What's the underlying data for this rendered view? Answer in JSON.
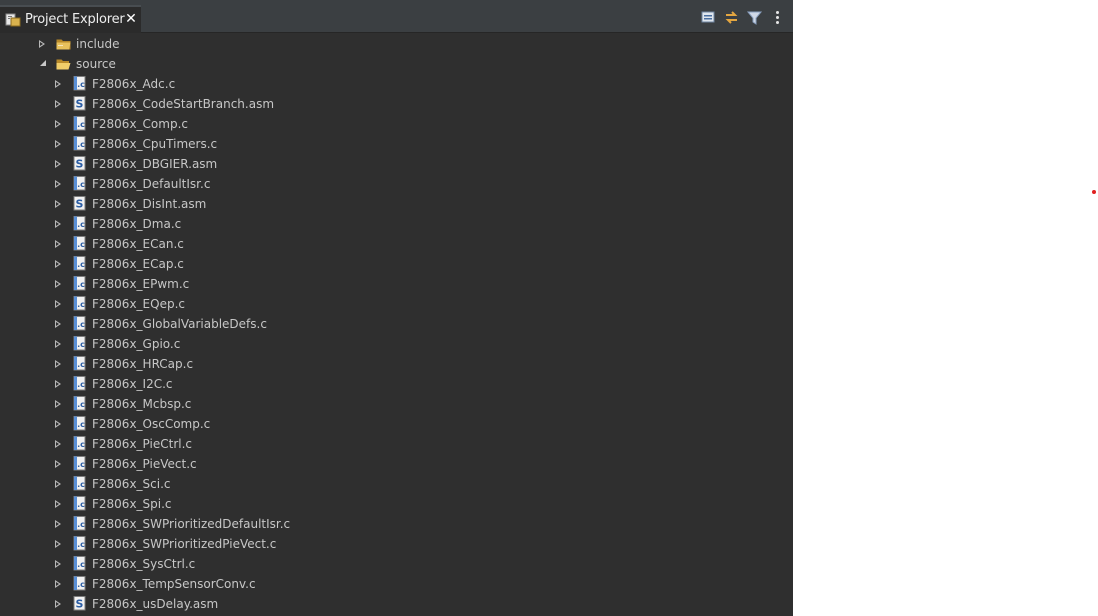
{
  "panel": {
    "tab_title": "Project Explorer",
    "tab_icon": "project-explorer-icon",
    "close_icon": "close-icon",
    "toolbar": [
      "collapse-all-icon",
      "link-with-editor-icon",
      "filter-icon",
      "view-menu-icon"
    ]
  },
  "colors": {
    "panel_bg": "#2f2f2f",
    "header_bg": "#3b3f42",
    "text": "#c7c7c7",
    "tab_text": "#eeeeee",
    "c_file_icon": "#5a8fd6",
    "asm_file_icon": "#ffffff",
    "folder": "#d9b24e"
  },
  "tree": {
    "folders": [
      {
        "label": "include",
        "expanded": false
      },
      {
        "label": "source",
        "expanded": true
      }
    ],
    "files": [
      {
        "label": "F2806x_Adc.c",
        "type": "c"
      },
      {
        "label": "F2806x_CodeStartBranch.asm",
        "type": "asm"
      },
      {
        "label": "F2806x_Comp.c",
        "type": "c"
      },
      {
        "label": "F2806x_CpuTimers.c",
        "type": "c"
      },
      {
        "label": "F2806x_DBGIER.asm",
        "type": "asm"
      },
      {
        "label": "F2806x_DefaultIsr.c",
        "type": "c"
      },
      {
        "label": "F2806x_DisInt.asm",
        "type": "asm"
      },
      {
        "label": "F2806x_Dma.c",
        "type": "c"
      },
      {
        "label": "F2806x_ECan.c",
        "type": "c"
      },
      {
        "label": "F2806x_ECap.c",
        "type": "c"
      },
      {
        "label": "F2806x_EPwm.c",
        "type": "c"
      },
      {
        "label": "F2806x_EQep.c",
        "type": "c"
      },
      {
        "label": "F2806x_GlobalVariableDefs.c",
        "type": "c"
      },
      {
        "label": "F2806x_Gpio.c",
        "type": "c"
      },
      {
        "label": "F2806x_HRCap.c",
        "type": "c"
      },
      {
        "label": "F2806x_I2C.c",
        "type": "c"
      },
      {
        "label": "F2806x_Mcbsp.c",
        "type": "c"
      },
      {
        "label": "F2806x_OscComp.c",
        "type": "c"
      },
      {
        "label": "F2806x_PieCtrl.c",
        "type": "c"
      },
      {
        "label": "F2806x_PieVect.c",
        "type": "c"
      },
      {
        "label": "F2806x_Sci.c",
        "type": "c"
      },
      {
        "label": "F2806x_Spi.c",
        "type": "c"
      },
      {
        "label": "F2806x_SWPrioritizedDefaultIsr.c",
        "type": "c"
      },
      {
        "label": "F2806x_SWPrioritizedPieVect.c",
        "type": "c"
      },
      {
        "label": "F2806x_SysCtrl.c",
        "type": "c"
      },
      {
        "label": "F2806x_TempSensorConv.c",
        "type": "c"
      },
      {
        "label": "F2806x_usDelay.asm",
        "type": "asm"
      }
    ]
  }
}
